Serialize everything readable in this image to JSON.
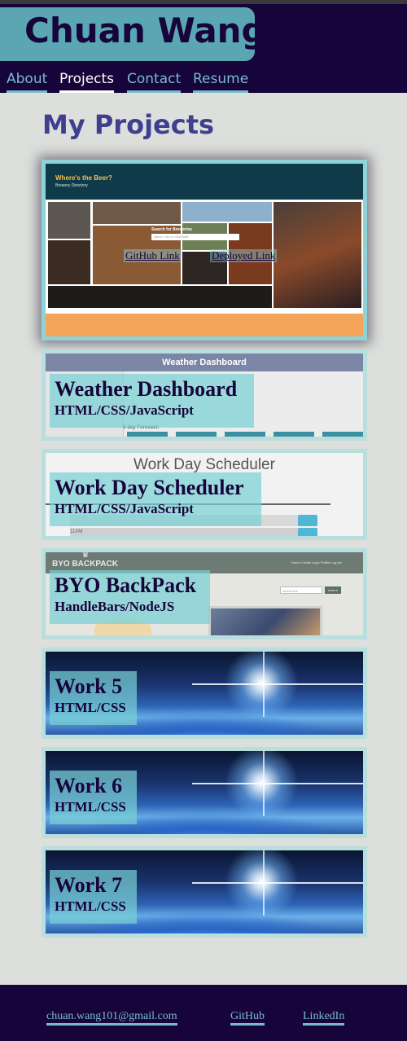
{
  "header": {
    "name": "Chuan Wang"
  },
  "nav": {
    "items": [
      {
        "label": "About"
      },
      {
        "label": "Projects"
      },
      {
        "label": "Contact"
      },
      {
        "label": "Resume"
      }
    ]
  },
  "main": {
    "title": "My Projects",
    "featured": {
      "thumb_title": "Where's the Beer?",
      "thumb_subtitle": "Brewery Directory",
      "search_label": "Search for Breweries",
      "search_placeholder": "Name / Zip or City/State",
      "github_link": "GitHub Link",
      "deployed_link": "Deployed Link"
    },
    "projects": [
      {
        "title": "Weather Dashboard",
        "tech": "HTML/CSS/JavaScript",
        "thumb_title": "Weather Dashboard",
        "thumb_extra": "5-day Forecast:"
      },
      {
        "title": "Work Day Scheduler",
        "tech": "HTML/CSS/JavaScript",
        "thumb_title": "Work Day Scheduler",
        "thumb_extra": "11AM"
      },
      {
        "title": "BYO BackPack",
        "tech": "HandleBars/NodeJS",
        "thumb_title": "BYO BACKPACK",
        "thumb_extra": "Home  Create Login  Profile  Log out",
        "thumb_search": "search bar",
        "thumb_search_btn": "search"
      },
      {
        "title": "Work 5",
        "tech": "HTML/CSS"
      },
      {
        "title": "Work 6",
        "tech": "HTML/CSS"
      },
      {
        "title": "Work 7",
        "tech": "HTML/CSS"
      }
    ]
  },
  "footer": {
    "email": "chuan.wang101@gmail.com",
    "github": "GitHub",
    "linkedin": "LinkedIn"
  },
  "colors": {
    "header_bg": "#16043a",
    "accent": "#78bccc",
    "title": "#3f3f8f",
    "page_bg": "#dcdfdb"
  }
}
